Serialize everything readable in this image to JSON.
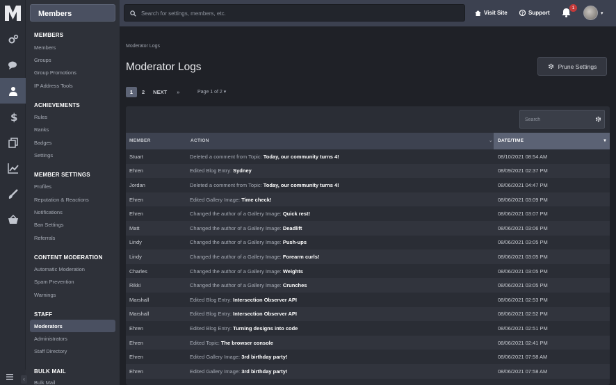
{
  "app": {
    "section_title": "Members"
  },
  "nav_icons": [
    "settings-gears-icon",
    "chat-icon",
    "members-icon",
    "dollar-icon",
    "copy-icon",
    "chart-icon",
    "brush-icon",
    "basket-icon"
  ],
  "sidebar": {
    "sections": [
      {
        "title": "MEMBERS",
        "items": [
          "Members",
          "Groups",
          "Group Promotions",
          "IP Address Tools"
        ]
      },
      {
        "title": "ACHIEVEMENTS",
        "items": [
          "Rules",
          "Ranks",
          "Badges",
          "Settings"
        ]
      },
      {
        "title": "MEMBER SETTINGS",
        "items": [
          "Profiles",
          "Reputation & Reactions",
          "Notifications",
          "Ban Settings",
          "Referrals"
        ]
      },
      {
        "title": "CONTENT MODERATION",
        "items": [
          "Automatic Moderation",
          "Spam Prevention",
          "Warnings"
        ]
      },
      {
        "title": "STAFF",
        "items": [
          "Moderators",
          "Administrators",
          "Staff Directory"
        ]
      },
      {
        "title": "BULK MAIL",
        "items": [
          "Bulk Mail"
        ]
      }
    ],
    "active_item": "Moderators",
    "collapse_glyph": "‹"
  },
  "topbar": {
    "search_placeholder": "Search for settings, members, etc.",
    "visit_site": "Visit Site",
    "support": "Support",
    "notification_count": "1"
  },
  "page": {
    "breadcrumb": "Moderator Logs",
    "title": "Moderator Logs",
    "prune_button": "Prune Settings",
    "pagination": {
      "pages": [
        "1",
        "2"
      ],
      "current": "1",
      "next": "NEXT",
      "last": "»",
      "page_of": "Page 1 of 2"
    },
    "table_search_placeholder": "Search",
    "columns": {
      "member": "MEMBER",
      "action": "ACTION",
      "date": "DATE/TIME"
    },
    "rows": [
      {
        "member": "Stuart",
        "prefix": "Deleted a comment from Topic: ",
        "subject": "Today, our community turns 4!",
        "date": "08/10/2021 08:54 AM"
      },
      {
        "member": "Ehren",
        "prefix": "Edited Blog Entry: ",
        "subject": "Sydney",
        "date": "08/09/2021 02:37 PM"
      },
      {
        "member": "Jordan",
        "prefix": "Deleted a comment from Topic: ",
        "subject": "Today, our community turns 4!",
        "date": "08/06/2021 04:47 PM"
      },
      {
        "member": "Ehren",
        "prefix": "Edited Gallery Image: ",
        "subject": "Time check!",
        "date": "08/06/2021 03:09 PM"
      },
      {
        "member": "Ehren",
        "prefix": "Changed the author of a Gallery Image: ",
        "subject": "Quick rest!",
        "date": "08/06/2021 03:07 PM"
      },
      {
        "member": "Matt",
        "prefix": "Changed the author of a Gallery Image: ",
        "subject": "Deadlift",
        "date": "08/06/2021 03:06 PM"
      },
      {
        "member": "Lindy",
        "prefix": "Changed the author of a Gallery Image: ",
        "subject": "Push-ups",
        "date": "08/06/2021 03:05 PM"
      },
      {
        "member": "Lindy",
        "prefix": "Changed the author of a Gallery Image: ",
        "subject": "Forearm curls!",
        "date": "08/06/2021 03:05 PM"
      },
      {
        "member": "Charles",
        "prefix": "Changed the author of a Gallery Image: ",
        "subject": "Weights",
        "date": "08/06/2021 03:05 PM"
      },
      {
        "member": "Rikki",
        "prefix": "Changed the author of a Gallery Image: ",
        "subject": "Crunches",
        "date": "08/06/2021 03:05 PM"
      },
      {
        "member": "Marshall",
        "prefix": "Edited Blog Entry: ",
        "subject": "Intersection Observer API",
        "date": "08/06/2021 02:53 PM"
      },
      {
        "member": "Marshall",
        "prefix": "Edited Blog Entry: ",
        "subject": "Intersection Observer API",
        "date": "08/06/2021 02:52 PM"
      },
      {
        "member": "Ehren",
        "prefix": "Edited Blog Entry: ",
        "subject": "Turning designs into code",
        "date": "08/06/2021 02:51 PM"
      },
      {
        "member": "Ehren",
        "prefix": "Edited Topic: ",
        "subject": "The browser console",
        "date": "08/06/2021 02:41 PM"
      },
      {
        "member": "Ehren",
        "prefix": "Edited Gallery Image: ",
        "subject": "3rd birthday party!",
        "date": "08/06/2021 07:58 AM"
      },
      {
        "member": "Ehren",
        "prefix": "Edited Gallery Image: ",
        "subject": "3rd birthday party!",
        "date": "08/06/2021 07:58 AM"
      }
    ]
  }
}
